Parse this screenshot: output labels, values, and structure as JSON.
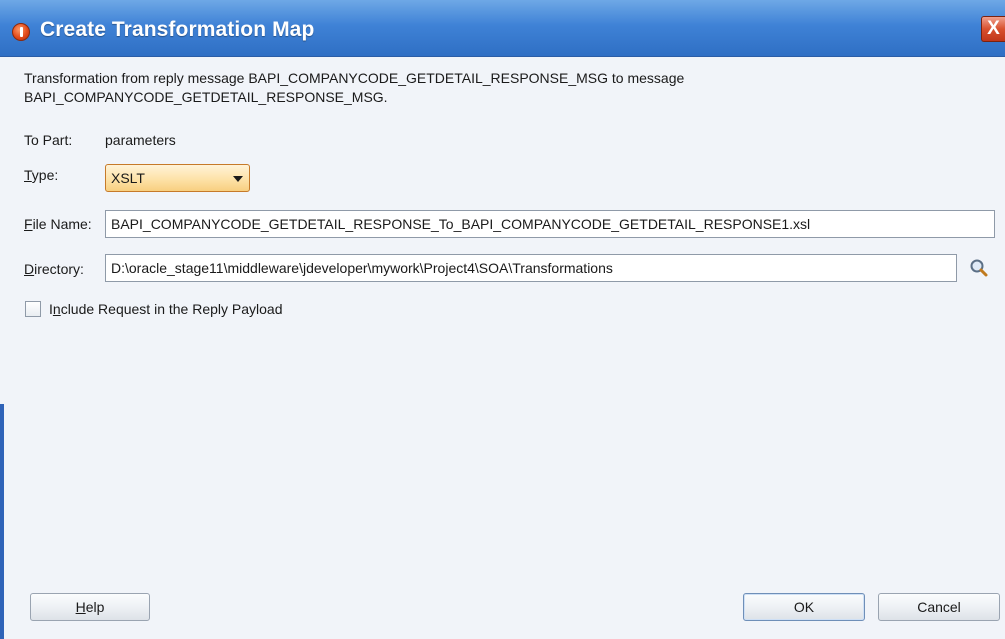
{
  "window": {
    "title": "Create Transformation Map",
    "close_label": "X"
  },
  "description": {
    "line1": "Transformation from reply message BAPI_COMPANYCODE_GETDETAIL_RESPONSE_MSG to message",
    "line2": "BAPI_COMPANYCODE_GETDETAIL_RESPONSE_MSG."
  },
  "to_part": {
    "label": "To Part:",
    "value": "parameters"
  },
  "type": {
    "label_mnemonic": "T",
    "label_rest": "ype:",
    "selected": "XSLT"
  },
  "file_name": {
    "label_mnemonic": "F",
    "label_rest": "ile Name:",
    "value": "BAPI_COMPANYCODE_GETDETAIL_RESPONSE_To_BAPI_COMPANYCODE_GETDETAIL_RESPONSE1.xsl"
  },
  "directory": {
    "label_mnemonic": "D",
    "label_rest": "irectory:",
    "value": "D:\\oracle_stage11\\middleware\\jdeveloper\\mywork\\Project4\\SOA\\Transformations"
  },
  "include_request": {
    "label_pre": "I",
    "label_mnemonic": "n",
    "label_rest": "clude Request in the Reply Payload",
    "checked": false
  },
  "buttons": {
    "help_mnemonic": "H",
    "help_rest": "elp",
    "ok": "OK",
    "cancel": "Cancel"
  },
  "colors": {
    "titlebar": "#3f82d6",
    "dialog_bg": "#f1f4f9",
    "type_select_bg": "#fde2a8",
    "close_button": "#d8502e"
  }
}
